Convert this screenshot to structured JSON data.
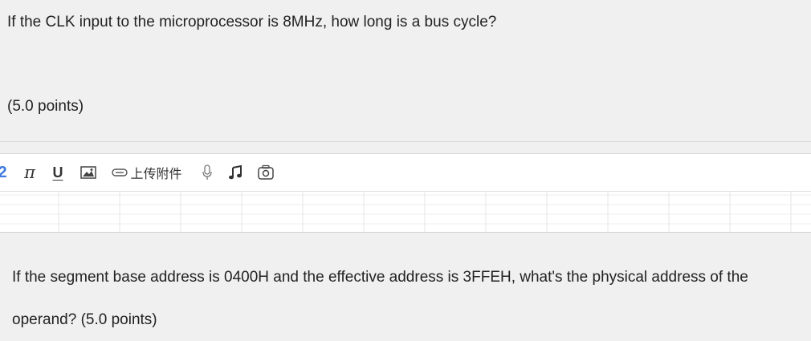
{
  "question1": {
    "text": "If the CLK input to the microprocessor is 8MHz, how long is a bus cycle?",
    "points": "(5.0 points)"
  },
  "toolbar": {
    "partial_glyph": "2",
    "pi_glyph": "π",
    "underline_glyph": "U",
    "attach_label": "上传附件",
    "icons": [
      "image-icon",
      "paperclip-icon",
      "microphone-icon",
      "music-note-icon",
      "camera-icon"
    ]
  },
  "question2": {
    "text": "If the segment base address is 0400H and the effective address is 3FFEH, what's the physical address of the operand? (5.0 points)"
  },
  "colors": {
    "background": "#f0f0f0",
    "editor_background": "#ffffff",
    "accent_blue": "#3f7be0"
  }
}
